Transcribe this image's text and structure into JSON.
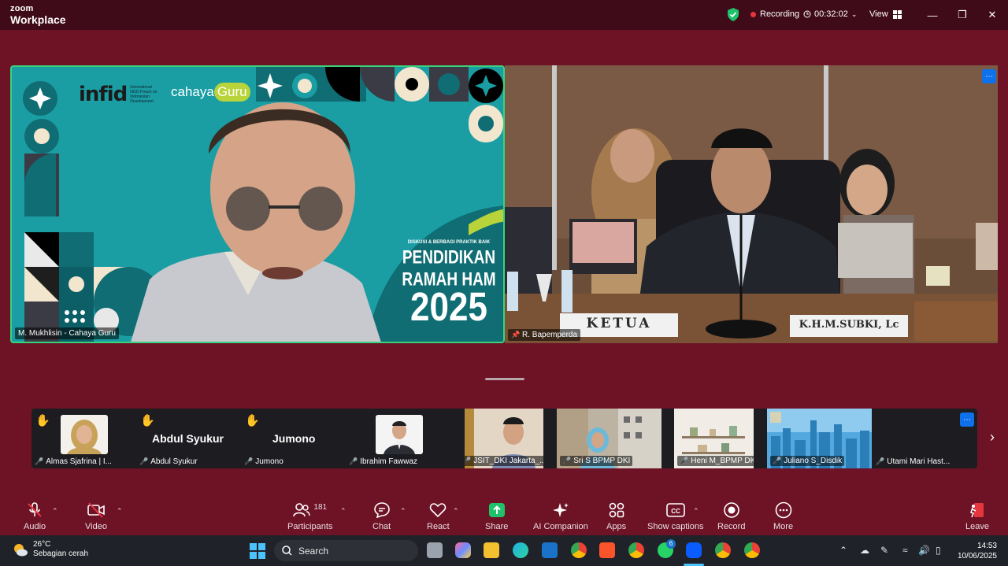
{
  "app": {
    "brand_small": "zoom",
    "brand_large": "Workplace"
  },
  "titlebar": {
    "recording_label": "Recording",
    "timer": "00:32:02",
    "view_label": "View"
  },
  "main_videos": [
    {
      "name": "M. Mukhlisin - Cahaya Guru",
      "active_speaker": true,
      "background": {
        "logo_1": "infid",
        "logo_1_sub": "International NGO Forum on Indonesian Development",
        "logo_2_a": "cahaya",
        "logo_2_b": "Guru",
        "event_kicker": "DISKUSI & BERBAGI PRAKTIK BAIK",
        "event_title_1": "PENDIDIKAN",
        "event_title_2": "RAMAH HAM",
        "event_year": "2025"
      }
    },
    {
      "name": "R. Bapemperda",
      "nameplate_1": "KETUA",
      "nameplate_2": "K.H.M.SUBKI, Lc"
    }
  ],
  "gallery": [
    {
      "name": "Almas Sjafrina | I...",
      "hand_raised": true,
      "video": "photo"
    },
    {
      "name": "Abdul Syukur",
      "display_name": "Abdul Syukur",
      "hand_raised": true,
      "video": "none"
    },
    {
      "name": "Jumono",
      "display_name": "Jumono",
      "hand_raised": true,
      "video": "none"
    },
    {
      "name": "Ibrahim Fawwaz",
      "hand_raised": false,
      "video": "photo"
    },
    {
      "name": "JSIT_DKI Jakarta_...",
      "hand_raised": false,
      "video": "camera"
    },
    {
      "name": "Sri S BPMP DKI",
      "hand_raised": false,
      "video": "camera"
    },
    {
      "name": "Heni M_BPMP DKI",
      "hand_raised": false,
      "video": "camera"
    },
    {
      "name": "Juliano S_Disdik",
      "hand_raised": false,
      "video": "camera"
    },
    {
      "name": "Utami Mari Hast...",
      "hand_raised": false,
      "video": "none"
    }
  ],
  "toolbar": {
    "audio": "Audio",
    "video": "Video",
    "participants": "Participants",
    "participants_count": "181",
    "chat": "Chat",
    "react": "React",
    "share": "Share",
    "ai_companion": "AI Companion",
    "apps": "Apps",
    "captions": "Show captions",
    "record": "Record",
    "more": "More",
    "leave": "Leave"
  },
  "taskbar": {
    "weather_temp": "26°C",
    "weather_desc": "Sebagian cerah",
    "search_label": "Search",
    "whatsapp_badge": "6",
    "time": "14:53",
    "date": "10/06/2025"
  },
  "colors": {
    "background": "#6e1226",
    "titlebar": "#3f0b18",
    "active_border": "#39d37b",
    "accent_blue": "#0e71eb",
    "recording_red": "#e5363c",
    "share_green": "#1fc26b",
    "leave_red": "#e5363c"
  }
}
